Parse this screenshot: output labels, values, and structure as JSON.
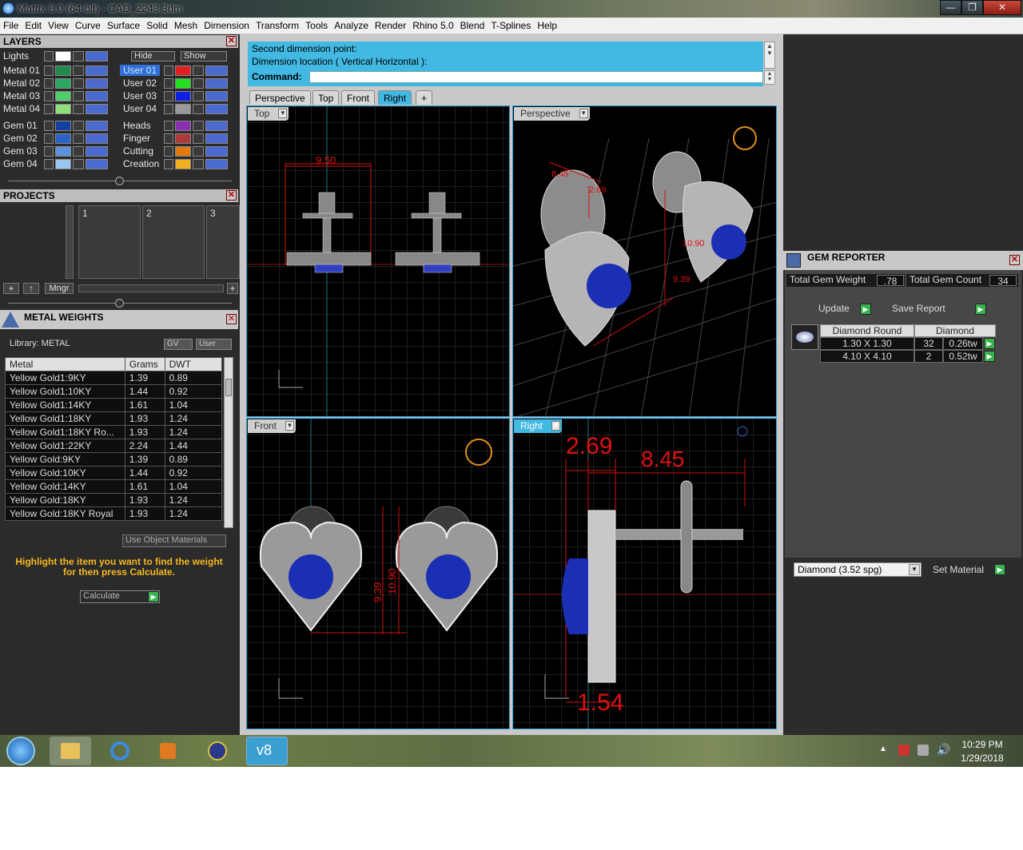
{
  "window": {
    "title": "Matrix 8.0 (64-bit) - CAD_2243.3dm",
    "min": "—",
    "max": "❐",
    "close": "✕"
  },
  "menu": [
    "File",
    "Edit",
    "View",
    "Curve",
    "Surface",
    "Solid",
    "Mesh",
    "Dimension",
    "Transform",
    "Tools",
    "Analyze",
    "Render",
    "Rhino 5.0",
    "Blend",
    "T-Splines",
    "Help"
  ],
  "layers": {
    "title": "LAYERS",
    "lights": "Lights",
    "hide": "Hide",
    "show": "Show",
    "left": [
      "Metal 01",
      "Metal 02",
      "Metal 03",
      "Metal 04",
      "Gem 01",
      "Gem 02",
      "Gem 03",
      "Gem 04"
    ],
    "right": [
      "User 01",
      "User 02",
      "User 03",
      "User 04",
      "Heads",
      "Finger",
      "Cutting",
      "Creation"
    ],
    "left_colors": [
      "#1f8a4a",
      "#2aa860",
      "#4fcf6a",
      "#8fe07a",
      "#1240a0",
      "#2a62c8",
      "#5a92e0",
      "#9cc4f0"
    ],
    "right_colors": [
      "#e02020",
      "#20e020",
      "#1020e0",
      "#9a9a9a",
      "#8a2fb0",
      "#b03a3a",
      "#e07a10",
      "#f0b020"
    ]
  },
  "projects": {
    "title": "PROJECTS",
    "slots": [
      "1",
      "2",
      "3"
    ],
    "mngr": "Mngr"
  },
  "metal": {
    "title": "METAL WEIGHTS",
    "library": "Library: METAL",
    "gv": "GV",
    "user": "User",
    "cols": [
      "Metal",
      "Grams",
      "DWT"
    ],
    "rows": [
      [
        "Yellow Gold1:9KY",
        "1.39",
        "0.89"
      ],
      [
        "Yellow Gold1:10KY",
        "1.44",
        "0.92"
      ],
      [
        "Yellow Gold1:14KY",
        "1.61",
        "1.04"
      ],
      [
        "Yellow Gold1:18KY",
        "1.93",
        "1.24"
      ],
      [
        "Yellow Gold1:18KY Ro...",
        "1.93",
        "1.24"
      ],
      [
        "Yellow Gold1:22KY",
        "2.24",
        "1.44"
      ],
      [
        "Yellow Gold:9KY",
        "1.39",
        "0.89"
      ],
      [
        "Yellow Gold:10KY",
        "1.44",
        "0.92"
      ],
      [
        "Yellow Gold:14KY",
        "1.61",
        "1.04"
      ],
      [
        "Yellow Gold:18KY",
        "1.93",
        "1.24"
      ],
      [
        "Yellow Gold:18KY Royal",
        "1.93",
        "1.24"
      ]
    ],
    "use_obj": "Use Object Materials",
    "hint": "Highlight the item you want to find the weight for then press Calculate.",
    "calculate": "Calculate"
  },
  "command": {
    "line1": "Second dimension point:",
    "line2": "Dimension location ( Vertical  Horizontal ):",
    "label": "Command:"
  },
  "tabs": [
    "Perspective",
    "Top",
    "Front",
    "Right",
    "+"
  ],
  "viewports": {
    "top": "Top",
    "perspective": "Perspective",
    "front": "Front",
    "right": "Right"
  },
  "dims": {
    "top_w": "9.50",
    "persp_a": "8.45",
    "persp_b": "2.69",
    "persp_c": "10.90",
    "persp_d": "9.39",
    "front_a": "9.39",
    "front_b": "10.90",
    "right_a": "2.69",
    "right_b": "8.45",
    "right_c": "1.54"
  },
  "gem": {
    "title": "GEM REPORTER",
    "total_weight_label": "Total Gem Weight",
    "total_weight": ".78",
    "total_count_label": "Total Gem Count",
    "total_count": "34",
    "update": "Update",
    "save": "Save Report",
    "col1": "Diamond Round",
    "col2": "Diamond",
    "rows": [
      [
        "1.30 X 1.30",
        "32",
        "0.26tw"
      ],
      [
        "4.10 X 4.10",
        "2",
        "0.52tw"
      ]
    ],
    "material": "Diamond    (3.52 spg)",
    "set_material": "Set Material"
  },
  "clock": {
    "time": "10:29 PM",
    "date": "1/29/2018"
  }
}
